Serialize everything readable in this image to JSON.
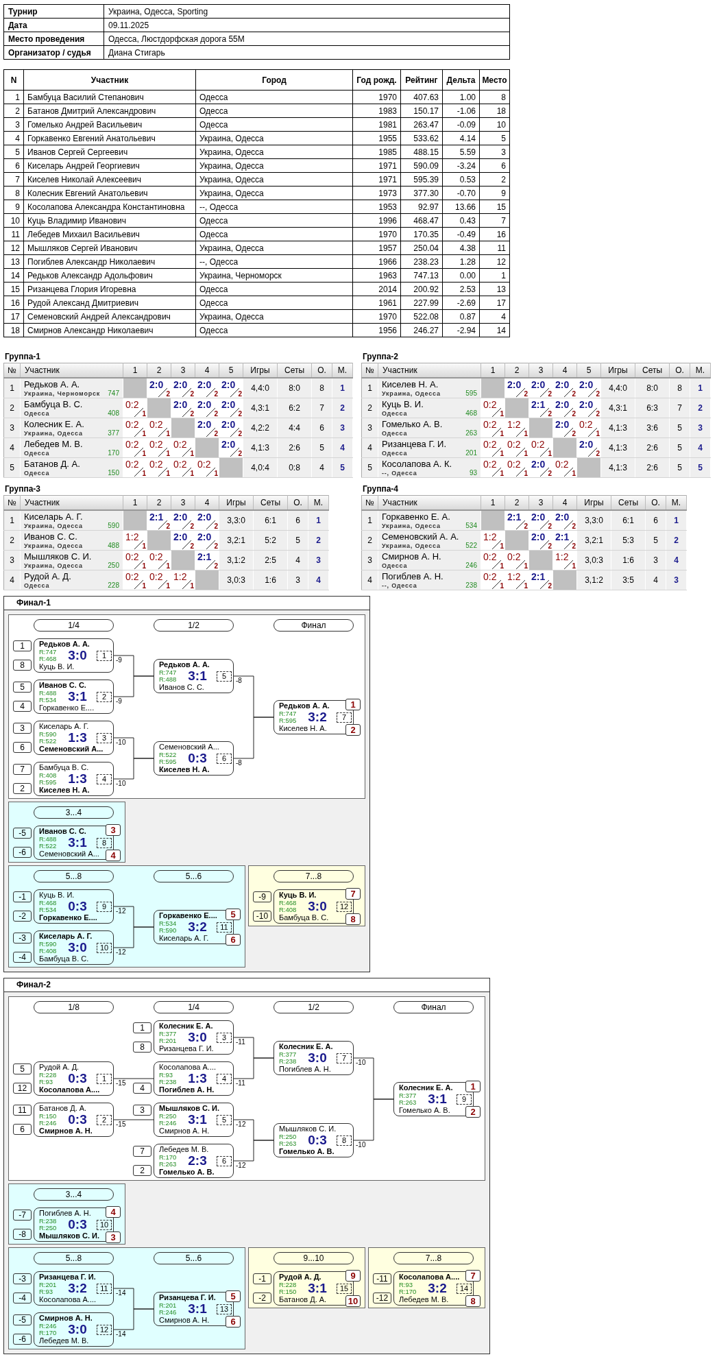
{
  "info": [
    {
      "label": "Турнир",
      "value": "Украина, Одесса, Sporting"
    },
    {
      "label": "Дата",
      "value": "09.11.2025"
    },
    {
      "label": "Место проведения",
      "value": "Одесса, Люстдорфская дорога 55М"
    },
    {
      "label": "Организатор / судья",
      "value": "Диана Стигарь"
    }
  ],
  "players": {
    "columns": [
      "N",
      "Участник",
      "Город",
      "Год рожд.",
      "Рейтинг",
      "Дельта",
      "Место"
    ],
    "rows": [
      [
        "1",
        "Бамбуца Василий Степанович",
        "Одесса",
        "1970",
        "407.63",
        "1.00",
        "8"
      ],
      [
        "2",
        "Батанов Дмитрий Александрович",
        "Одесса",
        "1983",
        "150.17",
        "-1.06",
        "18"
      ],
      [
        "3",
        "Гомелько Андрей Васильевич",
        "Одесса",
        "1981",
        "263.47",
        "-0.09",
        "10"
      ],
      [
        "4",
        "Горкавенко Евгений Анатольевич",
        "Украина, Одесса",
        "1955",
        "533.62",
        "4.14",
        "5"
      ],
      [
        "5",
        "Иванов Сергей Сергеевич",
        "Украина, Одесса",
        "1985",
        "488.15",
        "5.59",
        "3"
      ],
      [
        "6",
        "Киселарь Андрей Георгиевич",
        "Украина, Одесса",
        "1971",
        "590.09",
        "-3.24",
        "6"
      ],
      [
        "7",
        "Киселев Николай Алексеевич",
        "Украина, Одесса",
        "1971",
        "595.39",
        "0.53",
        "2"
      ],
      [
        "8",
        "Колесник Евгений Анатольевич",
        "Украина, Одесса",
        "1973",
        "377.30",
        "-0.70",
        "9"
      ],
      [
        "9",
        "Косолапова Александра Константиновна",
        "--, Одесса",
        "1953",
        "92.97",
        "13.66",
        "15"
      ],
      [
        "10",
        "Куць Владимир Иванович",
        "Одесса",
        "1996",
        "468.47",
        "0.43",
        "7"
      ],
      [
        "11",
        "Лебедев Михаил Васильевич",
        "Одесса",
        "1970",
        "170.35",
        "-0.49",
        "16"
      ],
      [
        "12",
        "Мышляков Сергей Иванович",
        "Украина, Одесса",
        "1957",
        "250.04",
        "4.38",
        "11"
      ],
      [
        "13",
        "Погиблев Александр Николаевич",
        "--, Одесса",
        "1966",
        "238.23",
        "1.28",
        "12"
      ],
      [
        "14",
        "Редьков Александр Адольфович",
        "Украина, Черноморск",
        "1963",
        "747.13",
        "0.00",
        "1"
      ],
      [
        "15",
        "Ризанцева Глория Игоревна",
        "Одесса",
        "2014",
        "200.92",
        "2.53",
        "13"
      ],
      [
        "16",
        "Рудой Александ Дмитриевич",
        "Одесса",
        "1961",
        "227.99",
        "-2.69",
        "17"
      ],
      [
        "17",
        "Семеновский Андрей Александрович",
        "Украина, Одесса",
        "1970",
        "522.08",
        "0.87",
        "4"
      ],
      [
        "18",
        "Смирнов Александр Николаевич",
        "Одесса",
        "1956",
        "246.27",
        "-2.94",
        "14"
      ]
    ]
  },
  "groups": [
    {
      "title": "Группа-1",
      "columns": [
        "№",
        "Участник",
        "1",
        "2",
        "3",
        "4",
        "5",
        "Игры",
        "Сеты",
        "О.",
        "М."
      ],
      "rows": [
        {
          "no": "1",
          "name": "Редьков А. А.",
          "city": "Украина, Черноморск",
          "rating": "747",
          "scores": [
            {
              "score": "2:0",
              "pts": "2",
              "won": true
            },
            {
              "score": "2:0",
              "pts": "2",
              "won": true
            },
            {
              "score": "2:0",
              "pts": "2",
              "won": true
            },
            {
              "score": "2:0",
              "pts": "2",
              "won": true
            }
          ],
          "games": "4,4:0",
          "sets": "8:0",
          "points": "8",
          "place": "1"
        },
        {
          "no": "2",
          "name": "Бамбуца В. С.",
          "city": "Одесса",
          "rating": "408",
          "scores": [
            {
              "score": "0:2",
              "pts": "1",
              "won": false
            },
            {
              "score": "2:0",
              "pts": "2",
              "won": true
            },
            {
              "score": "2:0",
              "pts": "2",
              "won": true
            },
            {
              "score": "2:0",
              "pts": "2",
              "won": true
            }
          ],
          "games": "4,3:1",
          "sets": "6:2",
          "points": "7",
          "place": "2"
        },
        {
          "no": "3",
          "name": "Колесник Е. А.",
          "city": "Украина, Одесса",
          "rating": "377",
          "scores": [
            {
              "score": "0:2",
              "pts": "1",
              "won": false
            },
            {
              "score": "0:2",
              "pts": "1",
              "won": false
            },
            {
              "score": "2:0",
              "pts": "2",
              "won": true
            },
            {
              "score": "2:0",
              "pts": "2",
              "won": true
            }
          ],
          "games": "4,2:2",
          "sets": "4:4",
          "points": "6",
          "place": "3"
        },
        {
          "no": "4",
          "name": "Лебедев М. В.",
          "city": "Одесса",
          "rating": "170",
          "scores": [
            {
              "score": "0:2",
              "pts": "1",
              "won": false
            },
            {
              "score": "0:2",
              "pts": "1",
              "won": false
            },
            {
              "score": "0:2",
              "pts": "1",
              "won": false
            },
            {
              "score": "2:0",
              "pts": "2",
              "won": true
            }
          ],
          "games": "4,1:3",
          "sets": "2:6",
          "points": "5",
          "place": "4"
        },
        {
          "no": "5",
          "name": "Батанов Д. А.",
          "city": "Одесса",
          "rating": "150",
          "scores": [
            {
              "score": "0:2",
              "pts": "1",
              "won": false
            },
            {
              "score": "0:2",
              "pts": "1",
              "won": false
            },
            {
              "score": "0:2",
              "pts": "1",
              "won": false
            },
            {
              "score": "0:2",
              "pts": "1",
              "won": false
            }
          ],
          "games": "4,0:4",
          "sets": "0:8",
          "points": "4",
          "place": "5"
        }
      ]
    },
    {
      "title": "Группа-2",
      "columns": [
        "№",
        "Участник",
        "1",
        "2",
        "3",
        "4",
        "5",
        "Игры",
        "Сеты",
        "О.",
        "М."
      ],
      "rows": [
        {
          "no": "1",
          "name": "Киселев Н. А.",
          "city": "Украина, Одесса",
          "rating": "595",
          "scores": [
            {
              "score": "2:0",
              "pts": "2",
              "won": true
            },
            {
              "score": "2:0",
              "pts": "2",
              "won": true
            },
            {
              "score": "2:0",
              "pts": "2",
              "won": true
            },
            {
              "score": "2:0",
              "pts": "2",
              "won": true
            }
          ],
          "games": "4,4:0",
          "sets": "8:0",
          "points": "8",
          "place": "1"
        },
        {
          "no": "2",
          "name": "Куць В. И.",
          "city": "Одесса",
          "rating": "468",
          "scores": [
            {
              "score": "0:2",
              "pts": "1",
              "won": false
            },
            {
              "score": "2:1",
              "pts": "2",
              "won": true
            },
            {
              "score": "2:0",
              "pts": "2",
              "won": true
            },
            {
              "score": "2:0",
              "pts": "2",
              "won": true
            }
          ],
          "games": "4,3:1",
          "sets": "6:3",
          "points": "7",
          "place": "2"
        },
        {
          "no": "3",
          "name": "Гомелько А. В.",
          "city": "Одесса",
          "rating": "263",
          "scores": [
            {
              "score": "0:2",
              "pts": "1",
              "won": false
            },
            {
              "score": "1:2",
              "pts": "1",
              "won": false
            },
            {
              "score": "2:0",
              "pts": "2",
              "won": true
            },
            {
              "score": "0:2",
              "pts": "1",
              "won": false
            }
          ],
          "games": "4,1:3",
          "sets": "3:6",
          "points": "5",
          "place": "3"
        },
        {
          "no": "4",
          "name": "Ризанцева Г. И.",
          "city": "Одесса",
          "rating": "201",
          "scores": [
            {
              "score": "0:2",
              "pts": "1",
              "won": false
            },
            {
              "score": "0:2",
              "pts": "1",
              "won": false
            },
            {
              "score": "0:2",
              "pts": "1",
              "won": false
            },
            {
              "score": "2:0",
              "pts": "2",
              "won": true
            }
          ],
          "games": "4,1:3",
          "sets": "2:6",
          "points": "5",
          "place": "4"
        },
        {
          "no": "5",
          "name": "Косолапова А. К.",
          "city": "--, Одесса",
          "rating": "93",
          "scores": [
            {
              "score": "0:2",
              "pts": "1",
              "won": false
            },
            {
              "score": "0:2",
              "pts": "1",
              "won": false
            },
            {
              "score": "2:0",
              "pts": "2",
              "won": true
            },
            {
              "score": "0:2",
              "pts": "1",
              "won": false
            }
          ],
          "games": "4,1:3",
          "sets": "2:6",
          "points": "5",
          "place": "5"
        }
      ]
    },
    {
      "title": "Группа-3",
      "columns": [
        "№",
        "Участник",
        "1",
        "2",
        "3",
        "4",
        "Игры",
        "Сеты",
        "О.",
        "М."
      ],
      "rows": [
        {
          "no": "1",
          "name": "Киселарь А. Г.",
          "city": "Украина, Одесса",
          "rating": "590",
          "scores": [
            {
              "score": "2:1",
              "pts": "2",
              "won": true
            },
            {
              "score": "2:0",
              "pts": "2",
              "won": true
            },
            {
              "score": "2:0",
              "pts": "2",
              "won": true
            }
          ],
          "games": "3,3:0",
          "sets": "6:1",
          "points": "6",
          "place": "1"
        },
        {
          "no": "2",
          "name": "Иванов С. С.",
          "city": "Украина, Одесса",
          "rating": "488",
          "scores": [
            {
              "score": "1:2",
              "pts": "1",
              "won": false
            },
            {
              "score": "2:0",
              "pts": "2",
              "won": true
            },
            {
              "score": "2:0",
              "pts": "2",
              "won": true
            }
          ],
          "games": "3,2:1",
          "sets": "5:2",
          "points": "5",
          "place": "2"
        },
        {
          "no": "3",
          "name": "Мышляков С. И.",
          "city": "Украина, Одесса",
          "rating": "250",
          "scores": [
            {
              "score": "0:2",
              "pts": "1",
              "won": false
            },
            {
              "score": "0:2",
              "pts": "1",
              "won": false
            },
            {
              "score": "2:1",
              "pts": "2",
              "won": true
            }
          ],
          "games": "3,1:2",
          "sets": "2:5",
          "points": "4",
          "place": "3"
        },
        {
          "no": "4",
          "name": "Рудой А. Д.",
          "city": "Одесса",
          "rating": "228",
          "scores": [
            {
              "score": "0:2",
              "pts": "1",
              "won": false
            },
            {
              "score": "0:2",
              "pts": "1",
              "won": false
            },
            {
              "score": "1:2",
              "pts": "1",
              "won": false
            }
          ],
          "games": "3,0:3",
          "sets": "1:6",
          "points": "3",
          "place": "4"
        }
      ]
    },
    {
      "title": "Группа-4",
      "columns": [
        "№",
        "Участник",
        "1",
        "2",
        "3",
        "4",
        "Игры",
        "Сеты",
        "О.",
        "М."
      ],
      "rows": [
        {
          "no": "1",
          "name": "Горкавенко Е. А.",
          "city": "Украина, Одесса",
          "rating": "534",
          "scores": [
            {
              "score": "2:1",
              "pts": "2",
              "won": true
            },
            {
              "score": "2:0",
              "pts": "2",
              "won": true
            },
            {
              "score": "2:0",
              "pts": "2",
              "won": true
            }
          ],
          "games": "3,3:0",
          "sets": "6:1",
          "points": "6",
          "place": "1"
        },
        {
          "no": "2",
          "name": "Семеновский А. А.",
          "city": "Украина, Одесса",
          "rating": "522",
          "scores": [
            {
              "score": "1:2",
              "pts": "1",
              "won": false
            },
            {
              "score": "2:0",
              "pts": "2",
              "won": true
            },
            {
              "score": "2:1",
              "pts": "2",
              "won": true
            }
          ],
          "games": "3,2:1",
          "sets": "5:3",
          "points": "5",
          "place": "2"
        },
        {
          "no": "3",
          "name": "Смирнов А. Н.",
          "city": "Одесса",
          "rating": "246",
          "scores": [
            {
              "score": "0:2",
              "pts": "1",
              "won": false
            },
            {
              "score": "0:2",
              "pts": "1",
              "won": false
            },
            {
              "score": "1:2",
              "pts": "1",
              "won": false
            }
          ],
          "games": "3,0:3",
          "sets": "1:6",
          "points": "3",
          "place": "4"
        },
        {
          "no": "4",
          "name": "Погиблев А. Н.",
          "city": "--, Одесса",
          "rating": "238",
          "scores": [
            {
              "score": "0:2",
              "pts": "1",
              "won": false
            },
            {
              "score": "1:2",
              "pts": "1",
              "won": false
            },
            {
              "score": "2:1",
              "pts": "2",
              "won": true
            }
          ],
          "games": "3,1:2",
          "sets": "3:5",
          "points": "4",
          "place": "3"
        }
      ]
    }
  ],
  "finals": [
    {
      "title": "Финал-1",
      "rows": [
        [
          {
            "color": "#ffffff",
            "rounds": [
              {
                "label": "1/4",
                "matches": [
                  {
                    "no": "1",
                    "score": "3:0",
                    "loser_to": "-9",
                    "players": [
                      {
                        "name": "Редьков А. А.",
                        "rating": "R:747",
                        "seed": "1",
                        "won": true
                      },
                      {
                        "name": "Куць В. И.",
                        "rating": "R:468",
                        "seed": "8",
                        "won": false
                      }
                    ]
                  },
                  {
                    "no": "2",
                    "score": "3:1",
                    "loser_to": "-9",
                    "players": [
                      {
                        "name": "Иванов С. С.",
                        "rating": "R:488",
                        "seed": "5",
                        "won": true
                      },
                      {
                        "name": "Горкавенко Е....",
                        "rating": "R:534",
                        "seed": "4",
                        "won": false
                      }
                    ]
                  },
                  {
                    "no": "3",
                    "score": "1:3",
                    "loser_to": "-10",
                    "players": [
                      {
                        "name": "Киселарь А. Г.",
                        "rating": "R:590",
                        "seed": "3",
                        "won": false
                      },
                      {
                        "name": "Семеновский А...",
                        "rating": "R:522",
                        "seed": "6",
                        "won": true
                      }
                    ]
                  },
                  {
                    "no": "4",
                    "score": "1:3",
                    "loser_to": "-10",
                    "players": [
                      {
                        "name": "Бамбуца В. С.",
                        "rating": "R:408",
                        "seed": "7",
                        "won": false
                      },
                      {
                        "name": "Киселев Н. А.",
                        "rating": "R:595",
                        "seed": "2",
                        "won": true
                      }
                    ]
                  }
                ]
              },
              {
                "label": "1/2",
                "matches": [
                  {
                    "no": "5",
                    "score": "3:1",
                    "loser_to": "-8",
                    "players": [
                      {
                        "name": "Редьков А. А.",
                        "rating": "R:747",
                        "won": true
                      },
                      {
                        "name": "Иванов С. С.",
                        "rating": "R:488",
                        "won": false
                      }
                    ]
                  },
                  {
                    "no": "6",
                    "score": "0:3",
                    "loser_to": "-8",
                    "players": [
                      {
                        "name": "Семеновский А...",
                        "rating": "R:522",
                        "won": false
                      },
                      {
                        "name": "Киселев Н. А.",
                        "rating": "R:595",
                        "won": true
                      }
                    ]
                  }
                ]
              },
              {
                "label": "Финал",
                "matches": [
                  {
                    "no": "7",
                    "score": "3:2",
                    "players": [
                      {
                        "name": "Редьков А. А.",
                        "rating": "R:747",
                        "won": true,
                        "place": "1"
                      },
                      {
                        "name": "Киселев Н. А.",
                        "rating": "R:595",
                        "won": false,
                        "place": "2"
                      }
                    ]
                  }
                ]
              }
            ]
          }
        ],
        [
          {
            "color": "#e0ffff",
            "rounds": [
              {
                "label": "3...4",
                "matches": [
                  {
                    "no": "8",
                    "score": "3:1",
                    "players": [
                      {
                        "name": "Иванов С. С.",
                        "rating": "R:488",
                        "seed": "-5",
                        "won": true,
                        "place": "3"
                      },
                      {
                        "name": "Семеновский А...",
                        "rating": "R:522",
                        "seed": "-6",
                        "won": false,
                        "place": "4"
                      }
                    ]
                  }
                ]
              }
            ]
          }
        ],
        [
          {
            "color": "#e0ffff",
            "rounds": [
              {
                "label": "5...8",
                "matches": [
                  {
                    "no": "9",
                    "score": "0:3",
                    "loser_to": "-12",
                    "players": [
                      {
                        "name": "Куць В. И.",
                        "rating": "R:468",
                        "seed": "-1",
                        "won": false
                      },
                      {
                        "name": "Горкавенко Е....",
                        "rating": "R:534",
                        "seed": "-2",
                        "won": true
                      }
                    ]
                  },
                  {
                    "no": "10",
                    "score": "3:0",
                    "loser_to": "-12",
                    "players": [
                      {
                        "name": "Киселарь А. Г.",
                        "rating": "R:590",
                        "seed": "-3",
                        "won": true
                      },
                      {
                        "name": "Бамбуца В. С.",
                        "rating": "R:408",
                        "seed": "-4",
                        "won": false
                      }
                    ]
                  }
                ]
              },
              {
                "label": "5...6",
                "matches": [
                  {
                    "no": "11",
                    "score": "3:2",
                    "players": [
                      {
                        "name": "Горкавенко Е....",
                        "rating": "R:534",
                        "won": true,
                        "place": "5"
                      },
                      {
                        "name": "Киселарь А. Г.",
                        "rating": "R:590",
                        "won": false,
                        "place": "6"
                      }
                    ]
                  }
                ]
              }
            ]
          },
          {
            "color": "#ffffe0",
            "rounds": [
              {
                "label": "7...8",
                "matches": [
                  {
                    "no": "12",
                    "score": "3:0",
                    "players": [
                      {
                        "name": "Куць В. И.",
                        "rating": "R:468",
                        "seed": "-9",
                        "won": true,
                        "place": "7"
                      },
                      {
                        "name": "Бамбуца В. С.",
                        "rating": "R:408",
                        "seed": "-10",
                        "won": false,
                        "place": "8"
                      }
                    ]
                  }
                ]
              }
            ]
          }
        ]
      ]
    },
    {
      "title": "Финал-2",
      "rows": [
        [
          {
            "color": "#ffffff",
            "rounds": [
              {
                "label": "1/8",
                "matches": [
                  {
                    "no": "1",
                    "score": "0:3",
                    "loser_to": "-15",
                    "players": [
                      {
                        "name": "Рудой А. Д.",
                        "rating": "R:228",
                        "seed": "5",
                        "won": false
                      },
                      {
                        "name": "Косолапова А....",
                        "rating": "R:93",
                        "seed": "12",
                        "won": true
                      }
                    ]
                  },
                  {
                    "no": "2",
                    "score": "0:3",
                    "loser_to": "-15",
                    "players": [
                      {
                        "name": "Батанов Д. А.",
                        "rating": "R:150",
                        "seed": "11",
                        "won": false
                      },
                      {
                        "name": "Смирнов А. Н.",
                        "rating": "R:246",
                        "seed": "6",
                        "won": true
                      }
                    ]
                  }
                ]
              },
              {
                "label": "1/4",
                "matches": [
                  {
                    "no": "3",
                    "score": "3:0",
                    "loser_to": "-11",
                    "players": [
                      {
                        "name": "Колесник Е. А.",
                        "rating": "R:377",
                        "seed": "1",
                        "won": true
                      },
                      {
                        "name": "Ризанцева Г. И.",
                        "rating": "R:201",
                        "seed": "8",
                        "won": false
                      }
                    ]
                  },
                  {
                    "no": "4",
                    "score": "1:3",
                    "loser_to": "-11",
                    "players": [
                      {
                        "name": "Косолапова А....",
                        "rating": "R:93",
                        "won": false
                      },
                      {
                        "name": "Погиблев А. Н.",
                        "rating": "R:238",
                        "seed": "4",
                        "won": true
                      }
                    ]
                  },
                  {
                    "no": "5",
                    "score": "3:1",
                    "loser_to": "-12",
                    "players": [
                      {
                        "name": "Мышляков С. И.",
                        "rating": "R:250",
                        "seed": "3",
                        "won": true
                      },
                      {
                        "name": "Смирнов А. Н.",
                        "rating": "R:246",
                        "won": false
                      }
                    ]
                  },
                  {
                    "no": "6",
                    "score": "2:3",
                    "loser_to": "-12",
                    "players": [
                      {
                        "name": "Лебедев М. В.",
                        "rating": "R:170",
                        "seed": "7",
                        "won": false
                      },
                      {
                        "name": "Гомелько А. В.",
                        "rating": "R:263",
                        "seed": "2",
                        "won": true
                      }
                    ]
                  }
                ]
              },
              {
                "label": "1/2",
                "matches": [
                  {
                    "no": "7",
                    "score": "3:0",
                    "loser_to": "-10",
                    "players": [
                      {
                        "name": "Колесник Е. А.",
                        "rating": "R:377",
                        "won": true
                      },
                      {
                        "name": "Погиблев А. Н.",
                        "rating": "R:238",
                        "won": false
                      }
                    ]
                  },
                  {
                    "no": "8",
                    "score": "0:3",
                    "loser_to": "-10",
                    "players": [
                      {
                        "name": "Мышляков С. И.",
                        "rating": "R:250",
                        "won": false
                      },
                      {
                        "name": "Гомелько А. В.",
                        "rating": "R:263",
                        "won": true
                      }
                    ]
                  }
                ]
              },
              {
                "label": "Финал",
                "matches": [
                  {
                    "no": "9",
                    "score": "3:1",
                    "players": [
                      {
                        "name": "Колесник Е. А.",
                        "rating": "R:377",
                        "won": true,
                        "place": "1"
                      },
                      {
                        "name": "Гомелько А. В.",
                        "rating": "R:263",
                        "won": false,
                        "place": "2"
                      }
                    ]
                  }
                ]
              }
            ]
          }
        ],
        [
          {
            "color": "#e0ffff",
            "rounds": [
              {
                "label": "3...4",
                "matches": [
                  {
                    "no": "10",
                    "score": "0:3",
                    "players": [
                      {
                        "name": "Погиблев А. Н.",
                        "rating": "R:238",
                        "seed": "-7",
                        "won": false,
                        "place": "4"
                      },
                      {
                        "name": "Мышляков С. И.",
                        "rating": "R:250",
                        "seed": "-8",
                        "won": true,
                        "place": "3"
                      }
                    ]
                  }
                ]
              }
            ]
          }
        ],
        [
          {
            "color": "#e0ffff",
            "rounds": [
              {
                "label": "5...8",
                "matches": [
                  {
                    "no": "11",
                    "score": "3:2",
                    "loser_to": "-14",
                    "players": [
                      {
                        "name": "Ризанцева Г. И.",
                        "rating": "R:201",
                        "seed": "-3",
                        "won": true
                      },
                      {
                        "name": "Косолапова А....",
                        "rating": "R:93",
                        "seed": "-4",
                        "won": false
                      }
                    ]
                  },
                  {
                    "no": "12",
                    "score": "3:0",
                    "loser_to": "-14",
                    "players": [
                      {
                        "name": "Смирнов А. Н.",
                        "rating": "R:246",
                        "seed": "-5",
                        "won": true
                      },
                      {
                        "name": "Лебедев М. В.",
                        "rating": "R:170",
                        "seed": "-6",
                        "won": false
                      }
                    ]
                  }
                ]
              },
              {
                "label": "5...6",
                "matches": [
                  {
                    "no": "13",
                    "score": "3:1",
                    "players": [
                      {
                        "name": "Ризанцева Г. И.",
                        "rating": "R:201",
                        "won": true,
                        "place": "5"
                      },
                      {
                        "name": "Смирнов А. Н.",
                        "rating": "R:246",
                        "won": false,
                        "place": "6"
                      }
                    ]
                  }
                ]
              }
            ]
          },
          {
            "color": "#ffffe0",
            "rounds": [
              {
                "label": "9...10",
                "matches": [
                  {
                    "no": "15",
                    "score": "3:1",
                    "players": [
                      {
                        "name": "Рудой А. Д.",
                        "rating": "R:228",
                        "seed": "-1",
                        "won": true,
                        "place": "9"
                      },
                      {
                        "name": "Батанов Д. А.",
                        "rating": "R:150",
                        "seed": "-2",
                        "won": false,
                        "place": "10"
                      }
                    ]
                  }
                ]
              }
            ]
          },
          {
            "color": "#ffffe0",
            "rounds": [
              {
                "label": "7...8",
                "matches": [
                  {
                    "no": "14",
                    "score": "3:2",
                    "players": [
                      {
                        "name": "Косолапова А....",
                        "rating": "R:93",
                        "seed": "-11",
                        "won": true,
                        "place": "7"
                      },
                      {
                        "name": "Лебедев М. В.",
                        "rating": "R:170",
                        "seed": "-12",
                        "won": false,
                        "place": "8"
                      }
                    ]
                  }
                ]
              }
            ]
          }
        ]
      ]
    }
  ]
}
